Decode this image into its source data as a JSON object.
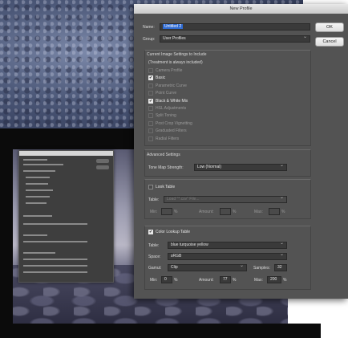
{
  "dialog": {
    "title": "New Profile",
    "name_label": "Name:",
    "name_value": "Untitled 2",
    "group_label": "Group:",
    "group_value": "User Profiles",
    "ok_label": "OK",
    "cancel_label": "Cancel"
  },
  "settings": {
    "heading": "Current Image Settings to Include",
    "note": "(Treatment is always included)",
    "items": [
      {
        "label": "Camera Profile",
        "checked": false,
        "enabled": false
      },
      {
        "label": "Basic",
        "checked": true,
        "enabled": true
      },
      {
        "label": "Parametric Curve",
        "checked": false,
        "enabled": false
      },
      {
        "label": "Point Curve",
        "checked": false,
        "enabled": false
      },
      {
        "label": "Black & White Mix",
        "checked": true,
        "enabled": true
      },
      {
        "label": "HSL Adjustments",
        "checked": false,
        "enabled": false
      },
      {
        "label": "Split Toning",
        "checked": false,
        "enabled": false
      },
      {
        "label": "Post Crop Vignetting",
        "checked": false,
        "enabled": false
      },
      {
        "label": "Graduated Filters",
        "checked": false,
        "enabled": false
      },
      {
        "label": "Radial Filters",
        "checked": false,
        "enabled": false
      }
    ]
  },
  "advanced": {
    "heading": "Advanced Settings",
    "tonemap_label": "Tone Map Strength:",
    "tonemap_value": "Low (Normal)"
  },
  "look_table": {
    "label": "Look Table",
    "checked": false,
    "table_label": "Table:",
    "table_value": "Load \"*.csv\" File...",
    "min_label": "Min:",
    "min_unit": "%",
    "amount_label": "Amount:",
    "amount_unit": "%",
    "max_label": "Max:",
    "max_unit": "%"
  },
  "color_lookup": {
    "label": "Color Lookup Table",
    "checked": true,
    "table_label": "Table:",
    "table_value": "blue turquoise yellow",
    "space_label": "Space:",
    "space_value": "sRGB",
    "gamut_label": "Gamut:",
    "gamut_value": "Clip",
    "samples_label": "Samples:",
    "samples_value": "32",
    "min_label": "Min:",
    "min_value": "0",
    "min_unit": "%",
    "amount_label": "Amount:",
    "amount_value": "77",
    "amount_unit": "%",
    "max_label": "Max:",
    "max_value": "200",
    "max_unit": "%"
  }
}
